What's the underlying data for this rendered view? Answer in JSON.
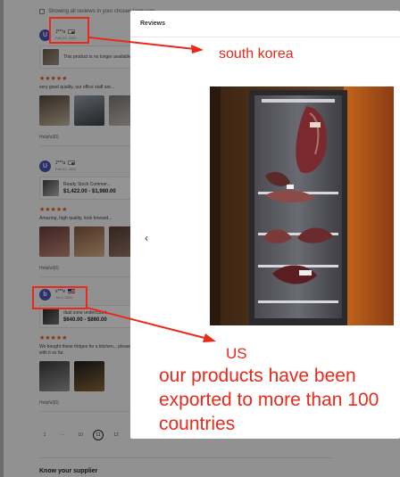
{
  "notice": {
    "text": "Showing all reviews in your chosen language"
  },
  "reviews": [
    {
      "avatar": "U",
      "name": "J***a",
      "date": "Feb 23, 2021",
      "product": {
        "title": "This product is no longer available",
        "price": ""
      },
      "stars": "★★★★★",
      "text": "very good quality, our office staff are...",
      "helpful": "Helpful(0)"
    },
    {
      "avatar": "U",
      "name": "J***a",
      "date": "Feb 23, 2021",
      "product": {
        "title": "Ready Stock Commer...",
        "price": "$1,422.00 - $1,980.00"
      },
      "stars": "★★★★★",
      "text": "Amazing, high quality, look forward...",
      "helpful": "Helpful(0)"
    },
    {
      "avatar": "b",
      "name": "s***e",
      "date": "Jul 2, 2020",
      "product": {
        "title": "dual zone undercount...",
        "price": "$640.00 - $860.00"
      },
      "stars": "★★★★★",
      "text": "We bought these fridges for a kitchen... pleased with it so far.",
      "helpful": "Helpful(0)"
    }
  ],
  "pagination": {
    "pages": [
      "1",
      "···",
      "10",
      "11",
      "12",
      "···",
      "12"
    ],
    "current": "11"
  },
  "supplier": {
    "title": "Know your supplier"
  },
  "modal": {
    "title": "Reviews",
    "prev": "‹"
  },
  "annotations": {
    "korea": "south korea",
    "us": "US",
    "export": "our products have been exported to more than 100 countries"
  },
  "colors": {
    "annotation": "#e8291c",
    "stars": "#e05a1a",
    "avatar": "#4a56b8"
  }
}
